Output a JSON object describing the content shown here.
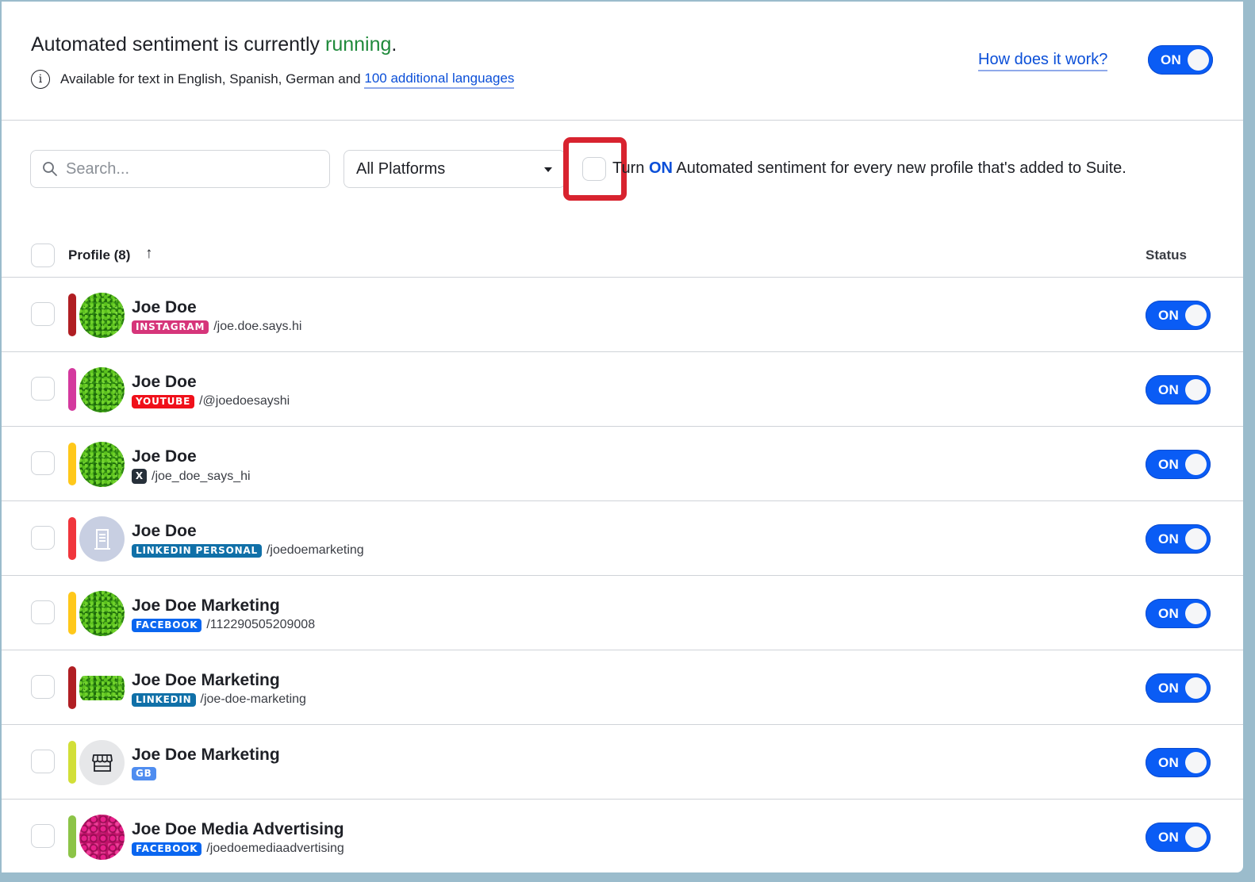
{
  "header": {
    "title_prefix": "Automated sentiment is currently ",
    "title_status": "running",
    "title_suffix": ".",
    "availability_text": "Available for text in English, Spanish, German and ",
    "languages_link": "100 additional languages",
    "how_link": "How does it work?",
    "master_toggle": {
      "label": "ON",
      "state": true
    }
  },
  "filters": {
    "search_placeholder": "Search...",
    "search_value": "",
    "platform_selected": "All Platforms",
    "auto_checkbox_checked": false,
    "auto_text_prefix": "Turn ",
    "auto_text_on": "ON",
    "auto_text_suffix": " Automated sentiment for every new profile that's added to Suite."
  },
  "table": {
    "profile_header": "Profile (8)",
    "sort_icon": "↑",
    "status_header": "Status",
    "rows": [
      {
        "name": "Joe Doe",
        "platform": "INSTAGRAM",
        "handle": "/joe.doe.says.hi",
        "bar_color": "#b01e23",
        "badge_color": "#d6357a",
        "avatar": "grass",
        "status": "ON"
      },
      {
        "name": "Joe Doe",
        "platform": "YOUTUBE",
        "handle": "/@joedoesayshi",
        "bar_color": "#d4399e",
        "badge_color": "#f0101a",
        "avatar": "grass",
        "status": "ON"
      },
      {
        "name": "Joe Doe",
        "platform": "X",
        "handle": "/joe_doe_says_hi",
        "bar_color": "#ffc81a",
        "badge_color": "#27303a",
        "avatar": "grass",
        "status": "ON"
      },
      {
        "name": "Joe Doe",
        "platform": "LINKEDIN PERSONAL",
        "handle": "/joedoemarketing",
        "bar_color": "#f0353c",
        "badge_color": "#1070a8",
        "avatar": "building",
        "status": "ON"
      },
      {
        "name": "Joe Doe Marketing",
        "platform": "FACEBOOK",
        "handle": "/112290505209008",
        "bar_color": "#ffc81a",
        "badge_color": "#0a66f0",
        "avatar": "grass",
        "status": "ON"
      },
      {
        "name": "Joe Doe Marketing",
        "platform": "LINKEDIN",
        "handle": "/joe-doe-marketing",
        "bar_color": "#b01e23",
        "badge_color": "#1070a8",
        "avatar": "banner",
        "status": "ON"
      },
      {
        "name": "Joe Doe Marketing",
        "platform": "GB",
        "handle": "",
        "bar_color": "#d2df38",
        "badge_color": "#4f8df0",
        "avatar": "store",
        "status": "ON"
      },
      {
        "name": "Joe Doe Media Advertising",
        "platform": "FACEBOOK",
        "handle": "/joedoemediaadvertising",
        "bar_color": "#8cc447",
        "badge_color": "#0a66f0",
        "avatar": "roses",
        "status": "ON"
      }
    ]
  }
}
